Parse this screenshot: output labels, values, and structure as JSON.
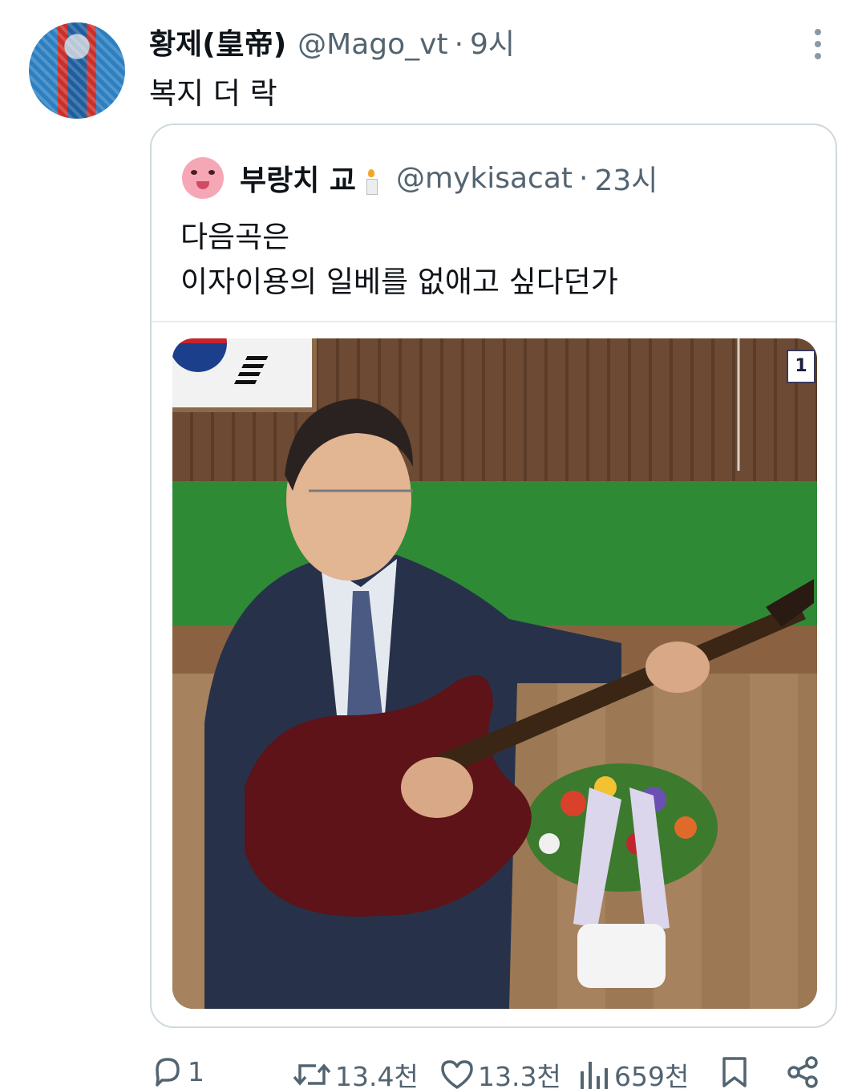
{
  "tweet": {
    "display_name": "황제(皇帝)",
    "handle": "@Mago_vt",
    "separator": "·",
    "time": "9시",
    "text": "복지 더 락"
  },
  "quote": {
    "display_name": "부랑치 교",
    "handle": "@mykisacat",
    "separator": "·",
    "time": "23시",
    "text_line1": "다음곡은",
    "text_line2": "이자이용의 일베를 없애고 싶다던가",
    "photo_badge": "1"
  },
  "actions": {
    "reply_count": "1",
    "retweet_count": "13.4천",
    "like_count": "13.3천",
    "view_count": "659천"
  },
  "icons": {
    "more": "more-vertical-icon",
    "reply": "reply-icon",
    "retweet": "retweet-icon",
    "like": "heart-icon",
    "views": "views-icon",
    "bookmark": "bookmark-icon",
    "share": "share-icon",
    "candle": "candle-icon"
  },
  "colors": {
    "text_primary": "#0f1419",
    "text_secondary": "#536471",
    "border": "#cfd9de"
  }
}
